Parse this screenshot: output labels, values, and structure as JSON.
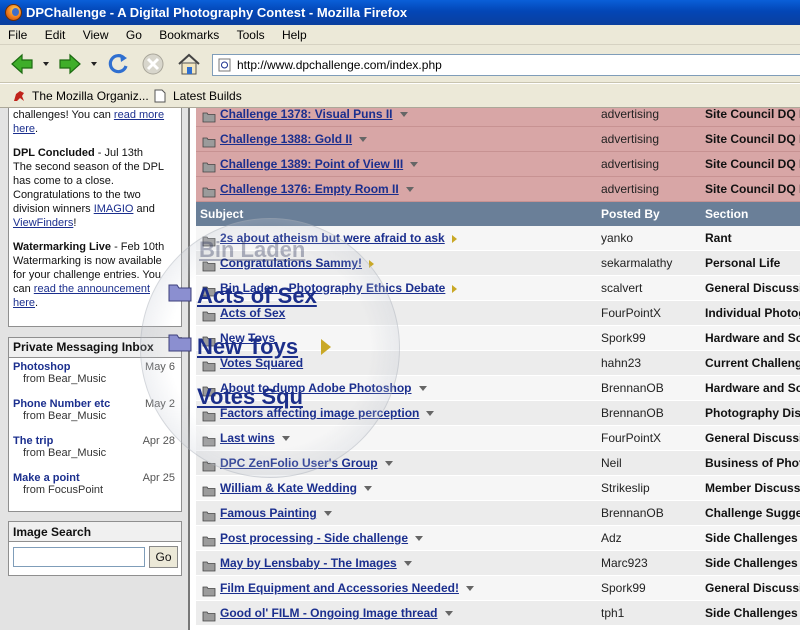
{
  "window": {
    "title": "DPChallenge - A Digital Photography Contest - Mozilla Firefox"
  },
  "menu": [
    "File",
    "Edit",
    "View",
    "Go",
    "Bookmarks",
    "Tools",
    "Help"
  ],
  "url": "http://www.dpchallenge.com/index.php",
  "bookmarks": [
    {
      "label": "The Mozilla Organiz...",
      "icon": "mozilla-dino-icon"
    },
    {
      "label": "Latest Builds",
      "icon": "page-icon"
    }
  ],
  "sidebar": {
    "news_top": {
      "pre": "challenges! You can ",
      "link": "read more",
      "link2": "here",
      "post": "."
    },
    "news": [
      {
        "title": "DPL Concluded",
        "date": " - Jul 13th",
        "body_pre": "The second season of the DPL has come to a close. Congratulations to the two division winners ",
        "link1": "IMAGIO",
        "mid": " and ",
        "link2": "ViewFinders",
        "post": "!"
      },
      {
        "title": "Watermarking Live",
        "date": " - Feb 10th",
        "body_pre": "Watermarking is now available for your challenge entries. You can ",
        "link1": "read the announcement",
        "mid": " ",
        "link2": "here",
        "post": "."
      }
    ],
    "pm": {
      "title": "Private Messaging Inbox",
      "items": [
        {
          "subject": "Photoshop",
          "from": "from Bear_Music",
          "date": "May 6"
        },
        {
          "subject": "Phone Number etc",
          "from": "from Bear_Music",
          "date": "May 2"
        },
        {
          "subject": "The trip",
          "from": "from Bear_Music",
          "date": "Apr 28"
        },
        {
          "subject": "Make a point",
          "from": "from FocusPoint",
          "date": "Apr 25"
        }
      ]
    },
    "search": {
      "title": "Image Search",
      "button": "Go",
      "value": ""
    }
  },
  "forum": {
    "pinned": [
      {
        "subject": "Challenge 1378: Visual Puns II",
        "by": "advertising",
        "section": "Site Council DQ D"
      },
      {
        "subject": "Challenge 1388: Gold II",
        "by": "advertising",
        "section": "Site Council DQ D"
      },
      {
        "subject": "Challenge 1389: Point of View III",
        "by": "advertising",
        "section": "Site Council DQ D"
      },
      {
        "subject": "Challenge 1376: Empty Room II",
        "by": "advertising",
        "section": "Site Council DQ D"
      }
    ],
    "headers": {
      "subject": "Subject",
      "posted_by": "Posted By",
      "section": "Section"
    },
    "rows": [
      {
        "subject": "2s about atheism but were afraid to ask",
        "by": "yanko",
        "section": "Rant",
        "marker": "right"
      },
      {
        "subject": "Congratulations Sammy!",
        "by": "sekarmalathy",
        "section": "Personal Life",
        "marker": "right"
      },
      {
        "subject": "Bin Laden - Photography Ethics Debate",
        "by": "scalvert",
        "section": "General Discussi",
        "marker": "right"
      },
      {
        "subject": "Acts of Sex",
        "by": "FourPointX",
        "section": "Individual Photog",
        "marker": "none"
      },
      {
        "subject": "New Toys",
        "by": "Spork99",
        "section": "Hardware and So",
        "marker": "none"
      },
      {
        "subject": "Votes Squared",
        "by": "hahn23",
        "section": "Current Challeng",
        "marker": "none"
      },
      {
        "subject": "About to dump Adobe Photoshop",
        "by": "BrennanOB",
        "section": "Hardware and So",
        "marker": "down"
      },
      {
        "subject": "Factors affecting image perception",
        "by": "BrennanOB",
        "section": "Photography Disc",
        "marker": "down"
      },
      {
        "subject": "Last wins",
        "by": "FourPointX",
        "section": "General Discussi",
        "marker": "down"
      },
      {
        "subject": "DPC ZenFolio User's Group",
        "by": "Neil",
        "section": "Business of Phot",
        "marker": "down"
      },
      {
        "subject": "William & Kate Wedding",
        "by": "Strikeslip",
        "section": "Member Discuss",
        "marker": "down"
      },
      {
        "subject": "Famous Painting",
        "by": "BrennanOB",
        "section": "Challenge Sugge",
        "marker": "down"
      },
      {
        "subject": "Post processing - Side challenge",
        "by": "Adz",
        "section": "Side Challenges",
        "marker": "down"
      },
      {
        "subject": "May by Lensbaby - The Images",
        "by": "Marc923",
        "section": "Side Challenges",
        "marker": "down"
      },
      {
        "subject": "Film Equipment and Accessories Needed!",
        "by": "Spork99",
        "section": "General Discussi",
        "marker": "down"
      },
      {
        "subject": "Good ol' FILM - Ongoing Image thread",
        "by": "tph1",
        "section": "Side Challenges",
        "marker": "down"
      }
    ]
  },
  "magnifier": {
    "lines": [
      "Bin Laden",
      "Acts of Sex",
      "New Toys",
      "Votes Squ"
    ]
  },
  "colors": {
    "pinned_bg": "#d8a6a6",
    "header_bg": "#6a7f98",
    "link": "#1b2f8e",
    "titlebar": "#0346b6"
  }
}
